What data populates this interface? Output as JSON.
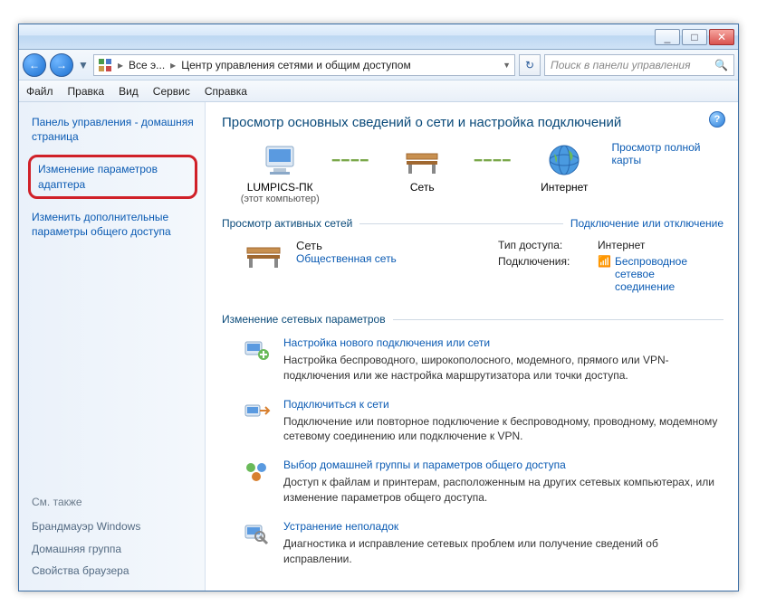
{
  "titlebar": {
    "min": "_",
    "max": "□",
    "close": "✕"
  },
  "nav": {
    "crumb1": "Все э...",
    "crumb2": "Центр управления сетями и общим доступом",
    "search_placeholder": "Поиск в панели управления"
  },
  "menu": {
    "file": "Файл",
    "edit": "Правка",
    "view": "Вид",
    "tools": "Сервис",
    "help": "Справка"
  },
  "sidebar": {
    "home": "Панель управления - домашняя страница",
    "adapter": "Изменение параметров адаптера",
    "advanced": "Изменить дополнительные параметры общего доступа",
    "seealso_heading": "См. также",
    "firewall": "Брандмауэр Windows",
    "homegroup": "Домашняя группа",
    "browser": "Свойства браузера"
  },
  "main": {
    "title": "Просмотр основных сведений о сети и настройка подключений",
    "full_map": "Просмотр полной карты",
    "pc_name": "LUMPICS-ПК",
    "pc_sub": "(этот компьютер)",
    "net_name": "Сеть",
    "internet": "Интернет",
    "active_heading": "Просмотр активных сетей",
    "conn_toggle": "Подключение или отключение",
    "net_label": "Сеть",
    "net_type": "Общественная сеть",
    "access_label": "Тип доступа:",
    "access_value": "Интернет",
    "connections_label": "Подключения:",
    "wireless": "Беспроводное сетевое соединение",
    "change_heading": "Изменение сетевых параметров",
    "tasks": [
      {
        "title": "Настройка нового подключения или сети",
        "desc": "Настройка беспроводного, широкополосного, модемного, прямого или VPN-подключения или же настройка маршрутизатора или точки доступа."
      },
      {
        "title": "Подключиться к сети",
        "desc": "Подключение или повторное подключение к беспроводному, проводному, модемному сетевому соединению или подключение к VPN."
      },
      {
        "title": "Выбор домашней группы и параметров общего доступа",
        "desc": "Доступ к файлам и принтерам, расположенным на других сетевых компьютерах, или изменение параметров общего доступа."
      },
      {
        "title": "Устранение неполадок",
        "desc": "Диагностика и исправление сетевых проблем или получение сведений об исправлении."
      }
    ]
  }
}
